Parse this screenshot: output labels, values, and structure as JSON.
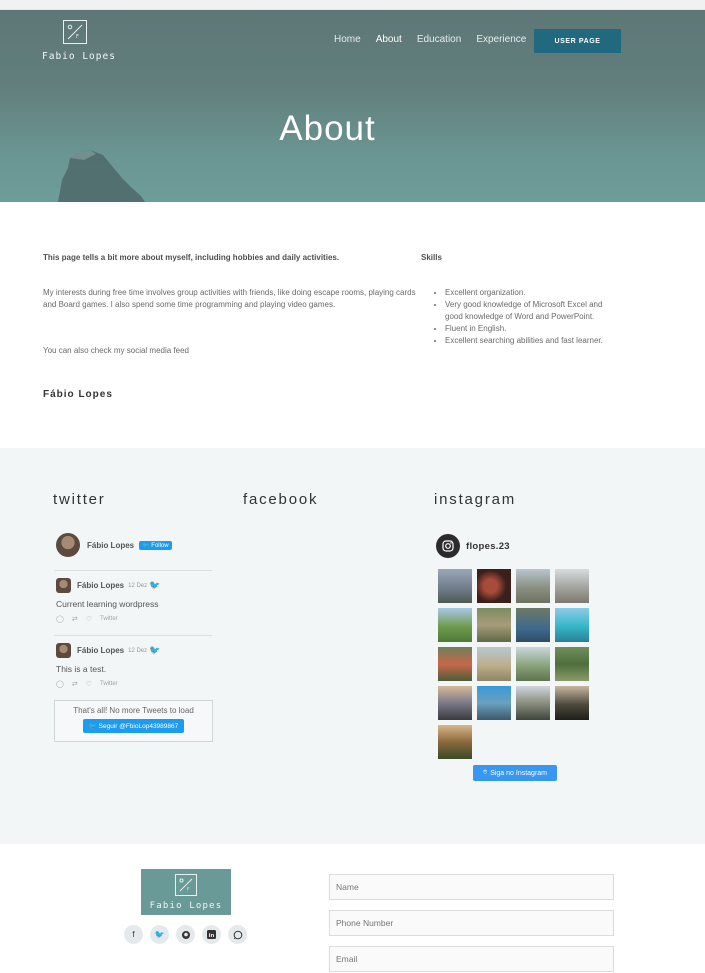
{
  "header": {
    "logo_name": "Fabio Lopes",
    "nav": [
      "Home",
      "About",
      "Education",
      "Experience"
    ],
    "active_nav": "About",
    "user_button": "USER PAGE",
    "page_title": "About",
    "accent": "#20697f"
  },
  "about": {
    "intro": "This page tells a bit more about myself, including hobbies and daily activities.",
    "paragraph": "My interests during free time involves group activities with friends, like doing escape rooms, playing cards and Board games. I also spend some time programming and playing video games.",
    "social_line": "You can also check my social media feed",
    "signature": "Fábio Lopes",
    "skills_title": "Skills",
    "skills": [
      "Excellent organization.",
      "Very good knowledge of Microsoft Excel and good knowledge of Word and PowerPoint.",
      "Fluent in English.",
      "Excellent searching abilities and fast learner."
    ]
  },
  "social": {
    "twitter_title": "twitter",
    "facebook_title": "facebook",
    "instagram_title": "instagram",
    "twitter": {
      "name": "Fábio Lopes",
      "follow": "Follow",
      "tweets": [
        {
          "author": "Fábio Lopes",
          "date": "12 Dez",
          "text": "Current learning wordpress",
          "action": "Twitter"
        },
        {
          "author": "Fábio Lopes",
          "date": "12 Dez",
          "text": "This is a test.",
          "action": "Twitter"
        }
      ],
      "no_more": "That's all! No more Tweets to load",
      "seguir": "Seguir @FbioLop43989867"
    },
    "instagram": {
      "username": "flopes.23",
      "follow_button": "Siga no Instagram",
      "button_color": "#3897f0"
    }
  },
  "footer": {
    "logo_name": "Fabio Lopes",
    "icons": [
      "facebook-icon",
      "twitter-icon",
      "github-icon",
      "linkedin-icon",
      "whatsapp-icon"
    ],
    "fields": [
      "Name",
      "Phone Number",
      "Email"
    ]
  }
}
